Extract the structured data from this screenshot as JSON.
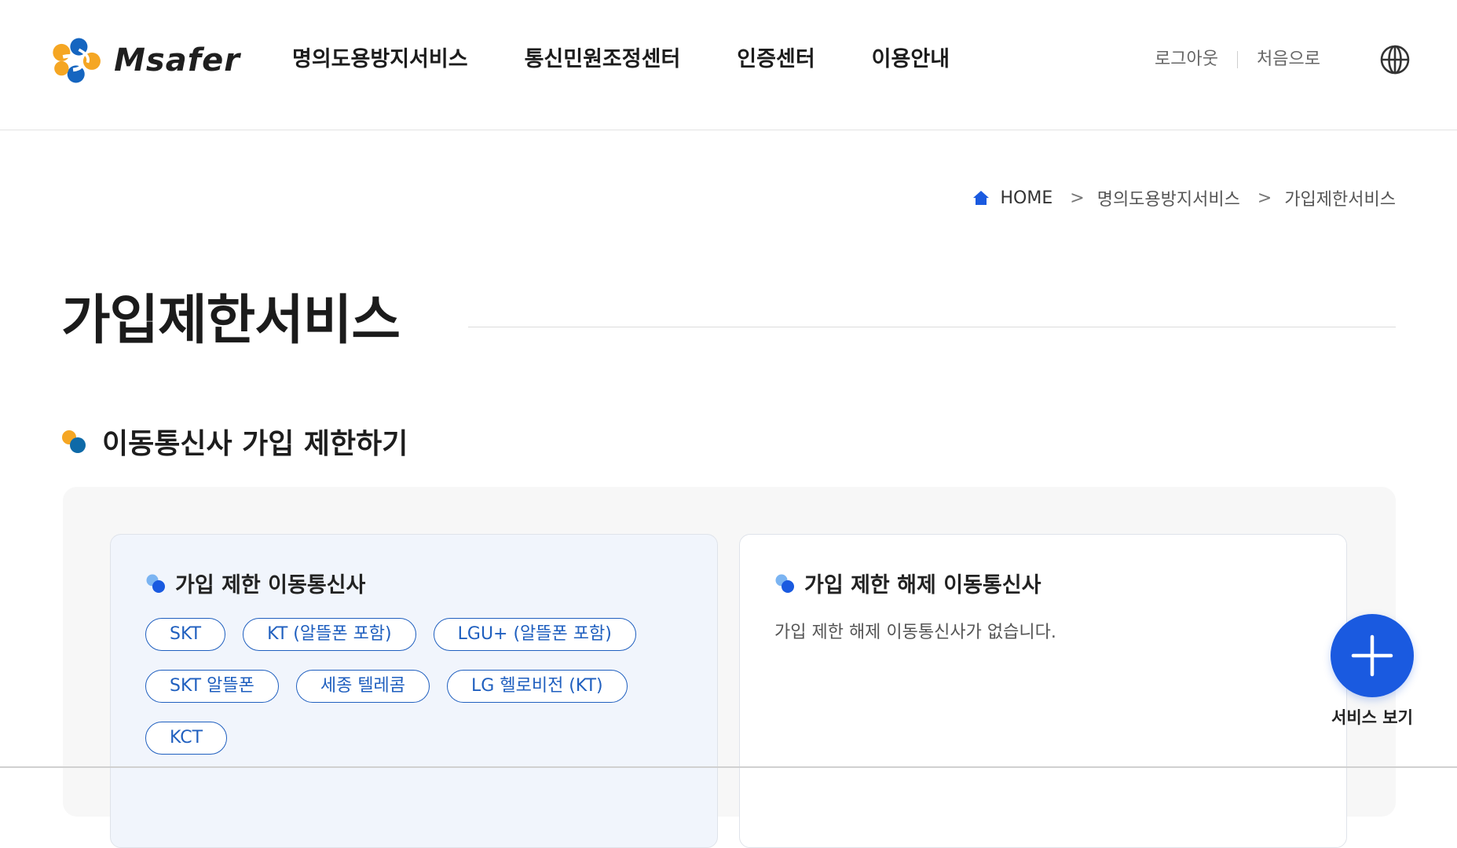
{
  "header": {
    "logo_text": "Msafer",
    "nav": [
      "명의도용방지서비스",
      "통신민원조정센터",
      "인증센터",
      "이용안내"
    ],
    "util": {
      "logout": "로그아웃",
      "home": "처음으로"
    }
  },
  "breadcrumb": {
    "home": "HOME",
    "level1": "명의도용방지서비스",
    "level2": "가입제한서비스",
    "separator": ">"
  },
  "page_title": "가입제한서비스",
  "section": {
    "title": "이동통신사 가입 제한하기"
  },
  "restricted": {
    "title": "가입 제한 이동통신사",
    "carriers": [
      "SKT",
      "KT (알뜰폰 포함)",
      "LGU+ (알뜰폰 포함)",
      "SKT 알뜰폰",
      "세종 텔레콤",
      "LG 헬로비전 (KT)",
      "KCT"
    ]
  },
  "unrestricted": {
    "title": "가입 제한 해제 이동통신사",
    "empty_message": "가입 제한 해제 이동통신사가 없습니다."
  },
  "fab": {
    "label": "서비스 보기"
  },
  "colors": {
    "accent_blue": "#1a5ae0",
    "chip_blue": "#1f5fbf",
    "logo_orange": "#f5a623",
    "logo_blue": "#1565c0"
  }
}
